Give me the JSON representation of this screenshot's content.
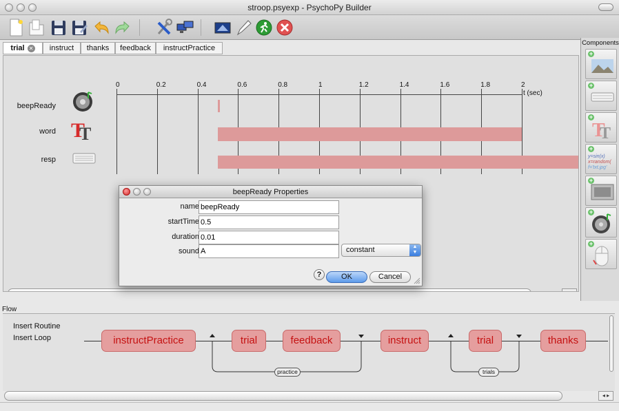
{
  "window": {
    "title": "stroop.psyexp - PsychoPy Builder"
  },
  "toolbar": {
    "buttons": [
      "new-file",
      "open-file",
      "save",
      "save-as",
      "undo",
      "redo",
      "preferences",
      "monitor-center",
      "experiment-settings",
      "compile-script",
      "run",
      "stop"
    ]
  },
  "tabs": [
    {
      "label": "trial",
      "active": true
    },
    {
      "label": "instruct"
    },
    {
      "label": "thanks"
    },
    {
      "label": "feedback"
    },
    {
      "label": "instructPractice"
    }
  ],
  "timeline": {
    "ticks": [
      "0",
      "0.2",
      "0.4",
      "0.6",
      "0.8",
      "1",
      "1.2",
      "1.4",
      "1.6",
      "1.8",
      "2"
    ],
    "unit_label": "t (sec)",
    "components": [
      {
        "name": "beepReady",
        "start": 0.5,
        "stop": 0.51,
        "icon": "sound-icon"
      },
      {
        "name": "word",
        "start": 0.5,
        "stop": 2.0,
        "icon": "text-icon"
      },
      {
        "name": "resp",
        "start": 0.5,
        "stop": 2.5,
        "icon": "keyboard-icon"
      }
    ]
  },
  "components_panel": {
    "title": "Components",
    "items": [
      "image-icon",
      "keyboard-icon",
      "text-icon",
      "code-icon",
      "movie-icon",
      "sound-icon",
      "mouse-icon"
    ],
    "code_text": [
      "y=sin(x)",
      "x=random(",
      "f='txt.jpg'"
    ]
  },
  "dialog": {
    "title": "beepReady Properties",
    "fields": [
      {
        "label": "name",
        "value": "beepReady"
      },
      {
        "label": "startTime",
        "value": "0.5"
      },
      {
        "label": "duration",
        "value": "0.01"
      },
      {
        "label": "sound",
        "value": "A"
      }
    ],
    "sound_select": "constant",
    "help": "?",
    "ok": "OK",
    "cancel": "Cancel"
  },
  "flow": {
    "title": "Flow",
    "insert_routine": "Insert Routine",
    "insert_loop": "Insert Loop",
    "routines": [
      "instructPractice",
      "trial",
      "feedback",
      "instruct",
      "trial",
      "thanks"
    ],
    "loops": [
      "practice",
      "trials"
    ]
  },
  "colors": {
    "routine_fill": "#e59e9e",
    "routine_text": "#c51212",
    "bar_fill": "#dd9a9a"
  }
}
